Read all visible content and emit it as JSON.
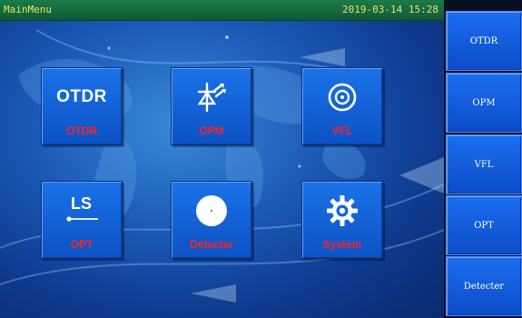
{
  "titlebar": {
    "title": "MainMenu",
    "datetime": "2019-03-14 15:28"
  },
  "tiles": [
    {
      "label": "OTDR",
      "icon": "otdr-text-icon",
      "icon_text": "OTDR"
    },
    {
      "label": "OPM",
      "icon": "photodiode-icon"
    },
    {
      "label": "VFL",
      "icon": "target-circle-icon"
    },
    {
      "label": "OPT",
      "icon": "light-source-icon",
      "icon_text": "LS"
    },
    {
      "label": "Detecter",
      "icon": "white-disc-icon"
    },
    {
      "label": "System",
      "icon": "gear-icon"
    }
  ],
  "side_menu": [
    "OTDR",
    "OPM",
    "VFL",
    "OPT",
    "Detecter"
  ],
  "colors": {
    "tile_label": "#ff2222",
    "titlebar_text": "#e8e36a",
    "titlebar_bg": "#0f5a34",
    "tile_bg": "#1565dc"
  }
}
